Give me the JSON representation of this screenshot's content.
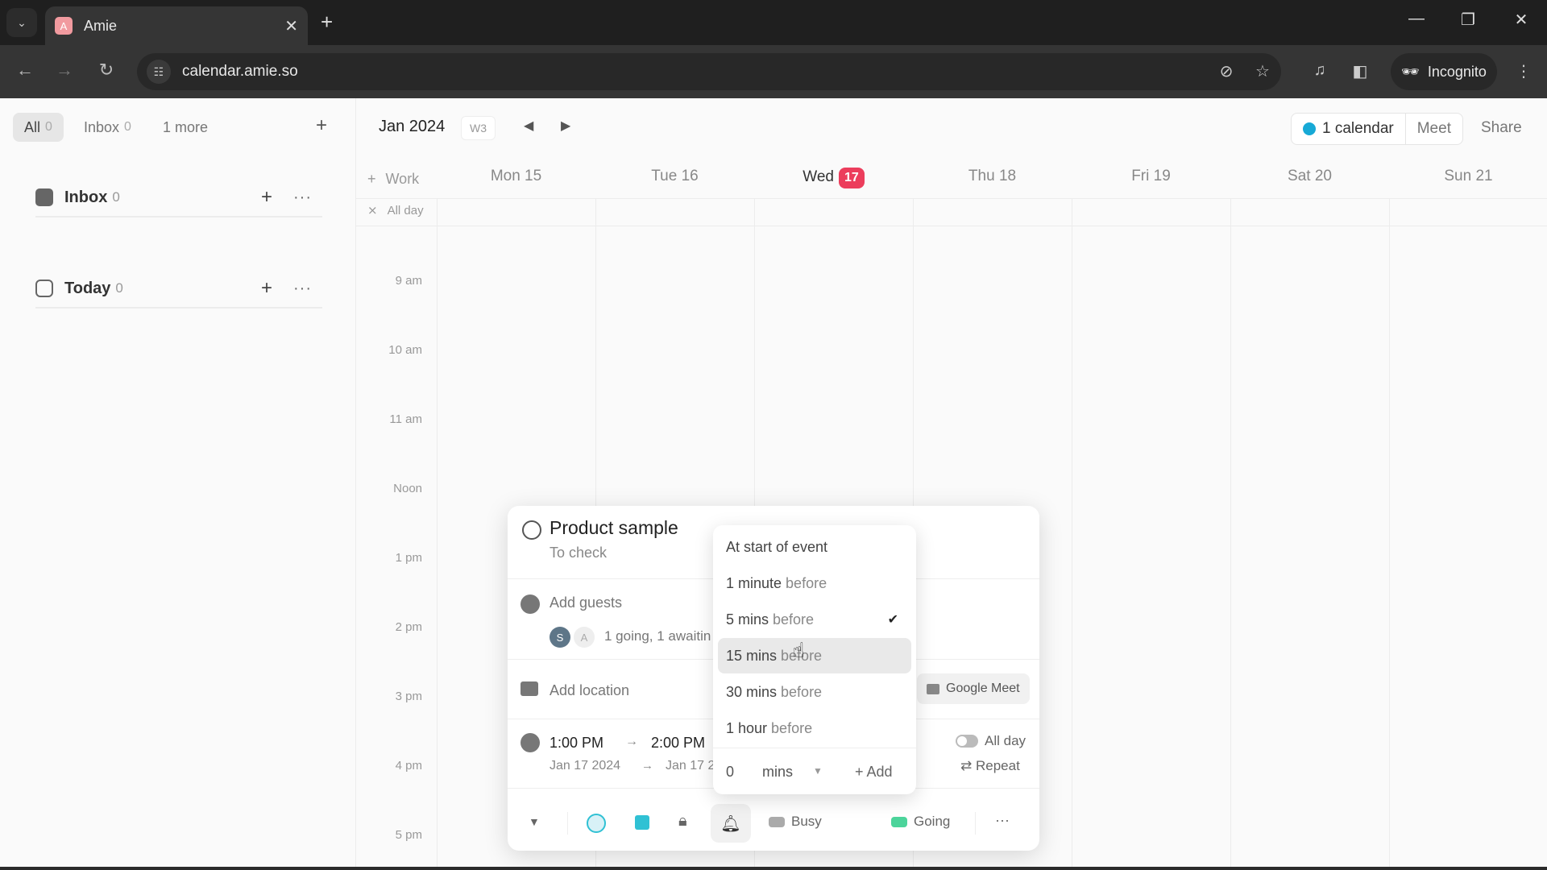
{
  "browser": {
    "tab_title": "Amie",
    "tab_favicon_letter": "A",
    "url": "calendar.amie.so",
    "profile_label": "Incognito"
  },
  "sidebar": {
    "tabs": [
      {
        "label": "All",
        "count": "0",
        "active": true
      },
      {
        "label": "Inbox",
        "count": "0",
        "active": false
      },
      {
        "label": "1 more",
        "count": "",
        "active": false
      }
    ],
    "sections": [
      {
        "name": "Inbox",
        "count": "0",
        "icon": "inbox-icon"
      },
      {
        "name": "Today",
        "count": "0",
        "icon": "today-icon"
      }
    ]
  },
  "calendar": {
    "month_label": "Jan 2024",
    "week_label": "W3",
    "calendars_label": "1 calendar",
    "calendar_color": "#17a9d6",
    "meet_label": "Meet",
    "share_label": "Share",
    "work_label": "Work",
    "allday_label": "All day",
    "days": [
      {
        "label": "Mon 15",
        "today": false
      },
      {
        "label": "Tue 16",
        "today": false
      },
      {
        "label": "Wed",
        "day": "17",
        "today": true
      },
      {
        "label": "Thu 18",
        "today": false
      },
      {
        "label": "Fri 19",
        "today": false
      },
      {
        "label": "Sat 20",
        "today": false
      },
      {
        "label": "Sun 21",
        "today": false
      }
    ],
    "hours": [
      "9 am",
      "10 am",
      "11 am",
      "Noon",
      "1 pm",
      "2 pm",
      "3 pm",
      "4 pm",
      "5 pm"
    ],
    "today_color": "#ec3d5c"
  },
  "event_popup": {
    "title": "Product sample",
    "subtitle": "To check",
    "add_guests_label": "Add guests",
    "guests": [
      {
        "initial": "S"
      },
      {
        "initial": "A"
      }
    ],
    "guest_status": "1 going, 1 awaitin",
    "add_location_label": "Add location",
    "meet_button_label": "Google Meet",
    "start_time": "1:00 PM",
    "end_time": "2:00 PM",
    "start_date": "Jan 17 2024",
    "end_date": "Jan 17 2",
    "allday_label": "All day",
    "allday_on": false,
    "repeat_label": "Repeat",
    "busy_label": "Busy",
    "going_label": "Going",
    "going_color": "#4cd49b"
  },
  "reminder_dropdown": {
    "items": [
      {
        "main": "At start of event",
        "suffix": "",
        "selected": false,
        "hover": false
      },
      {
        "main": "1 minute",
        "suffix": "before",
        "selected": false,
        "hover": false
      },
      {
        "main": "5 mins",
        "suffix": "before",
        "selected": true,
        "hover": false
      },
      {
        "main": "15 mins",
        "suffix": "before",
        "selected": false,
        "hover": true
      },
      {
        "main": "30 mins",
        "suffix": "before",
        "selected": false,
        "hover": false
      },
      {
        "main": "1 hour",
        "suffix": "before",
        "selected": false,
        "hover": false
      }
    ],
    "custom_value": "0",
    "custom_unit": "mins",
    "add_label": "+ Add"
  }
}
